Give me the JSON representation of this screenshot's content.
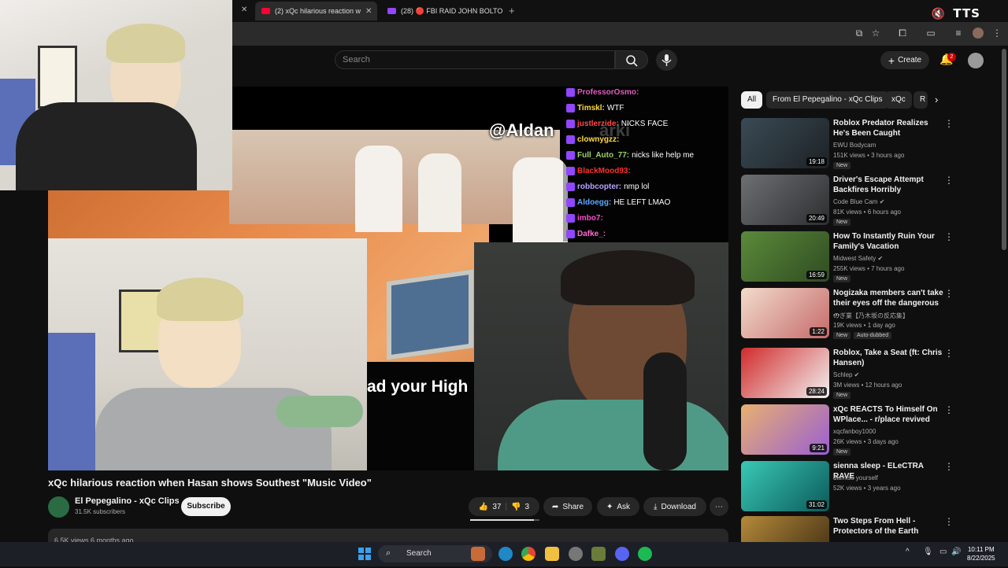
{
  "browser": {
    "tabs": [
      {
        "label": "(2) xQc hilarious reaction w",
        "active": true
      },
      {
        "label": "(28) 🔴 FBI RAID JOHN BOLTON",
        "active": false
      }
    ],
    "tts_label": "TTS"
  },
  "youtube": {
    "search_placeholder": "Search",
    "create_label": "Create",
    "notification_count": "2"
  },
  "video": {
    "overlay_handle": "@Aldan",
    "overlay_handle_2": "arki",
    "overlay_caption": "ad your High",
    "chat": [
      {
        "user": "ProfessorOsmo:",
        "msg": "",
        "color": "#e05cc0"
      },
      {
        "user": "Timskl:",
        "msg": "WTF",
        "color": "#ffd84a"
      },
      {
        "user": "justlerzide:",
        "msg": "NICKS FACE",
        "color": "#ff4a4a"
      },
      {
        "user": "clownygzz:",
        "msg": "",
        "color": "#ffd84a"
      },
      {
        "user": "Full_Auto_77:",
        "msg": "nicks like help me",
        "color": "#9bd36a"
      },
      {
        "user": "BlackMood93:",
        "msg": "",
        "color": "#ff3030"
      },
      {
        "user": "robbcopter:",
        "msg": "nmp lol",
        "color": "#b9a3ff"
      },
      {
        "user": "Aldoegg:",
        "msg": "HE LEFT LMAO",
        "color": "#5aa8ff"
      },
      {
        "user": "imbo7:",
        "msg": "",
        "color": "#ff4ad0"
      },
      {
        "user": "Dafke_:",
        "msg": "",
        "color": "#ff6ad0"
      }
    ]
  },
  "below": {
    "title": "xQc hilarious reaction when Hasan shows Southest \"Music Video\"",
    "channel": "El Pepegalino - xQc Clips",
    "subscribers": "31.5K subscribers",
    "subscribe_label": "Subscribe",
    "likes": "37",
    "dislikes": "3",
    "share_label": "Share",
    "ask_label": "Ask",
    "download_label": "Download",
    "views_meta": "6.5K views  6 months ago"
  },
  "sidebar": {
    "chips": [
      "All",
      "From El Pepegalino - xQc Clips",
      "xQc",
      "R"
    ],
    "recs": [
      {
        "title": "Roblox Predator Realizes He's Been Caught",
        "channel": "EWU Bodycam",
        "meta": "151K views • 3 hours ago",
        "badge": "New",
        "duration": "19:18"
      },
      {
        "title": "Driver's Escape Attempt Backfires Horribly",
        "channel": "Code Blue Cam ✔",
        "meta": "81K views • 6 hours ago",
        "badge": "New",
        "duration": "20:49"
      },
      {
        "title": "How To Instantly Ruin Your Family's Vacation",
        "channel": "Midwest Safety ✔",
        "meta": "255K views • 7 hours ago",
        "badge": "New",
        "duration": "16:59"
      },
      {
        "title": "Nogizaka members can't take their eyes off the dangerous ...",
        "channel": "のぎ業【乃木坂の反応集】",
        "meta": "19K views • 1 day ago",
        "badge": "New",
        "badge2": "Auto-dubbed",
        "duration": "1:22"
      },
      {
        "title": "Roblox, Take a Seat (ft: Chris Hansen)",
        "channel": "Schlep ✔",
        "meta": "3M views • 12 hours ago",
        "badge": "New",
        "duration": "28:24"
      },
      {
        "title": "xQc REACTS To Himself On WPlace... - r/place revived",
        "channel": "xqcfanboy1000",
        "meta": "26K views • 3 days ago",
        "badge": "New",
        "duration": "9:21"
      },
      {
        "title": "sienna sleep - ELeCTRA RAVE",
        "channel": "dismiss yourself",
        "meta": "52K views • 3 years ago",
        "badge": "",
        "duration": "31:02"
      },
      {
        "title": "Two Steps From Hell - Protectors of the Earth",
        "channel": "",
        "meta": "",
        "badge": "",
        "duration": ""
      }
    ]
  },
  "taskbar": {
    "search_label": "Search",
    "time": "10:11 PM",
    "date": "8/22/2025"
  }
}
